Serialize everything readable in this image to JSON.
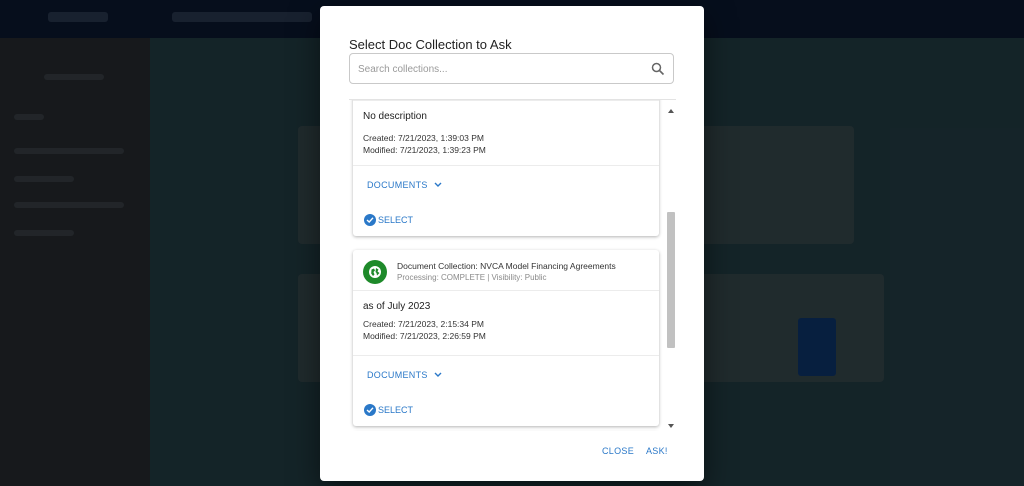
{
  "modal": {
    "title": "Select Doc Collection to Ask",
    "search_placeholder": "Search collections..."
  },
  "collections": [
    {
      "description": "No description",
      "created": "Created: 7/21/2023, 1:39:03 PM",
      "modified": "Modified: 7/21/2023, 1:39:23 PM",
      "documents_label": "DOCUMENTS",
      "select_label": "SELECT"
    },
    {
      "title": "Document Collection: NVCA Model Financing Agreements",
      "status": "Processing: COMPLETE | Visibility: Public",
      "description": "as of July 2023",
      "created": "Created: 7/21/2023, 2:15:34 PM",
      "modified": "Modified: 7/21/2023, 2:26:59 PM",
      "documents_label": "DOCUMENTS",
      "select_label": "SELECT",
      "avatar_icon": "globe-icon",
      "avatar_color": "#1e8a2a"
    }
  ],
  "footer": {
    "close_label": "CLOSE",
    "ask_label": "ASK!"
  },
  "colors": {
    "accent": "#2a78c8"
  }
}
